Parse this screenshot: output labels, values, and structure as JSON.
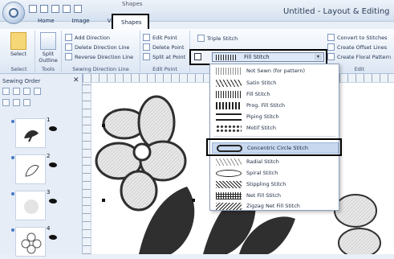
{
  "window": {
    "title": "Untitled - Layout & Editing",
    "context_tab": "Shapes"
  },
  "tabs": [
    "Home",
    "Image",
    "View",
    "Shapes"
  ],
  "ribbon": {
    "select_label": "Select",
    "split_outline_label": "Split Outline",
    "group_select": "Select",
    "group_tools": "Tools",
    "direction_items": [
      "Add Direction",
      "Delete Direction Line",
      "Reverse Direction Line"
    ],
    "group_direction": "Sewing Direction Line",
    "point_items": [
      "Edit Point",
      "Delete Point",
      "Split at Point"
    ],
    "group_point": "Edit Point",
    "triple_stitch": "Triple Stitch",
    "edit_items": [
      "Convert to Stitches",
      "Create Offset Lines",
      "Create Floral Pattern"
    ],
    "group_edit": "Edit"
  },
  "stitch_select": {
    "value": "Fill Stitch"
  },
  "sidebar": {
    "title": "Sewing Order",
    "close": "✕",
    "items": [
      {
        "number": "1"
      },
      {
        "number": "2"
      },
      {
        "number": "3"
      },
      {
        "number": "4"
      }
    ]
  },
  "dropdown": {
    "items": [
      "Not Sewn (for pattern)",
      "Satin Stitch",
      "Fill Stitch",
      "Prog. Fill Stitch",
      "Piping Stitch",
      "Motif Stitch",
      "Concentric Circle Stitch",
      "Radial Stitch",
      "Spiral Stitch",
      "Stippling Stitch",
      "Net Fill Stitch",
      "Zigzag Net Fill Stitch"
    ],
    "highlighted": "Concentric Circle Stitch"
  }
}
